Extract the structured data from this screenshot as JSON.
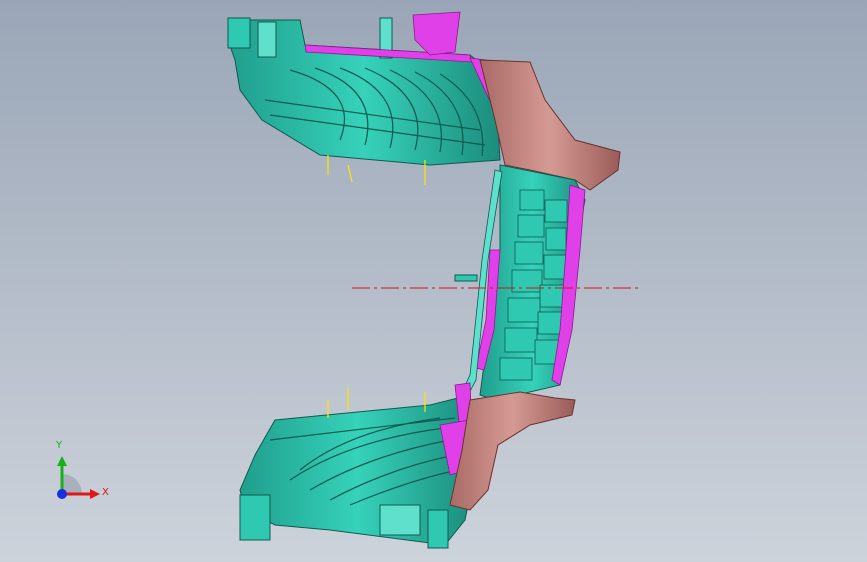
{
  "viewport": {
    "background_top": "#9aa6b7",
    "background_bottom": "#cdd3db"
  },
  "model": {
    "colors": {
      "teal": "#2fc8b0",
      "teal_dark": "#1a8a7a",
      "teal_light": "#5fe0cc",
      "magenta": "#e040e8",
      "rose": "#c98a86",
      "rose_dark": "#8a4a48",
      "centerline": "#d01818",
      "yellow_marks": "#ffe600"
    }
  },
  "triad": {
    "x_label": "X",
    "y_label": "Y",
    "x_color": "#e01818",
    "y_color": "#18b018",
    "z_color": "#1830e0"
  }
}
